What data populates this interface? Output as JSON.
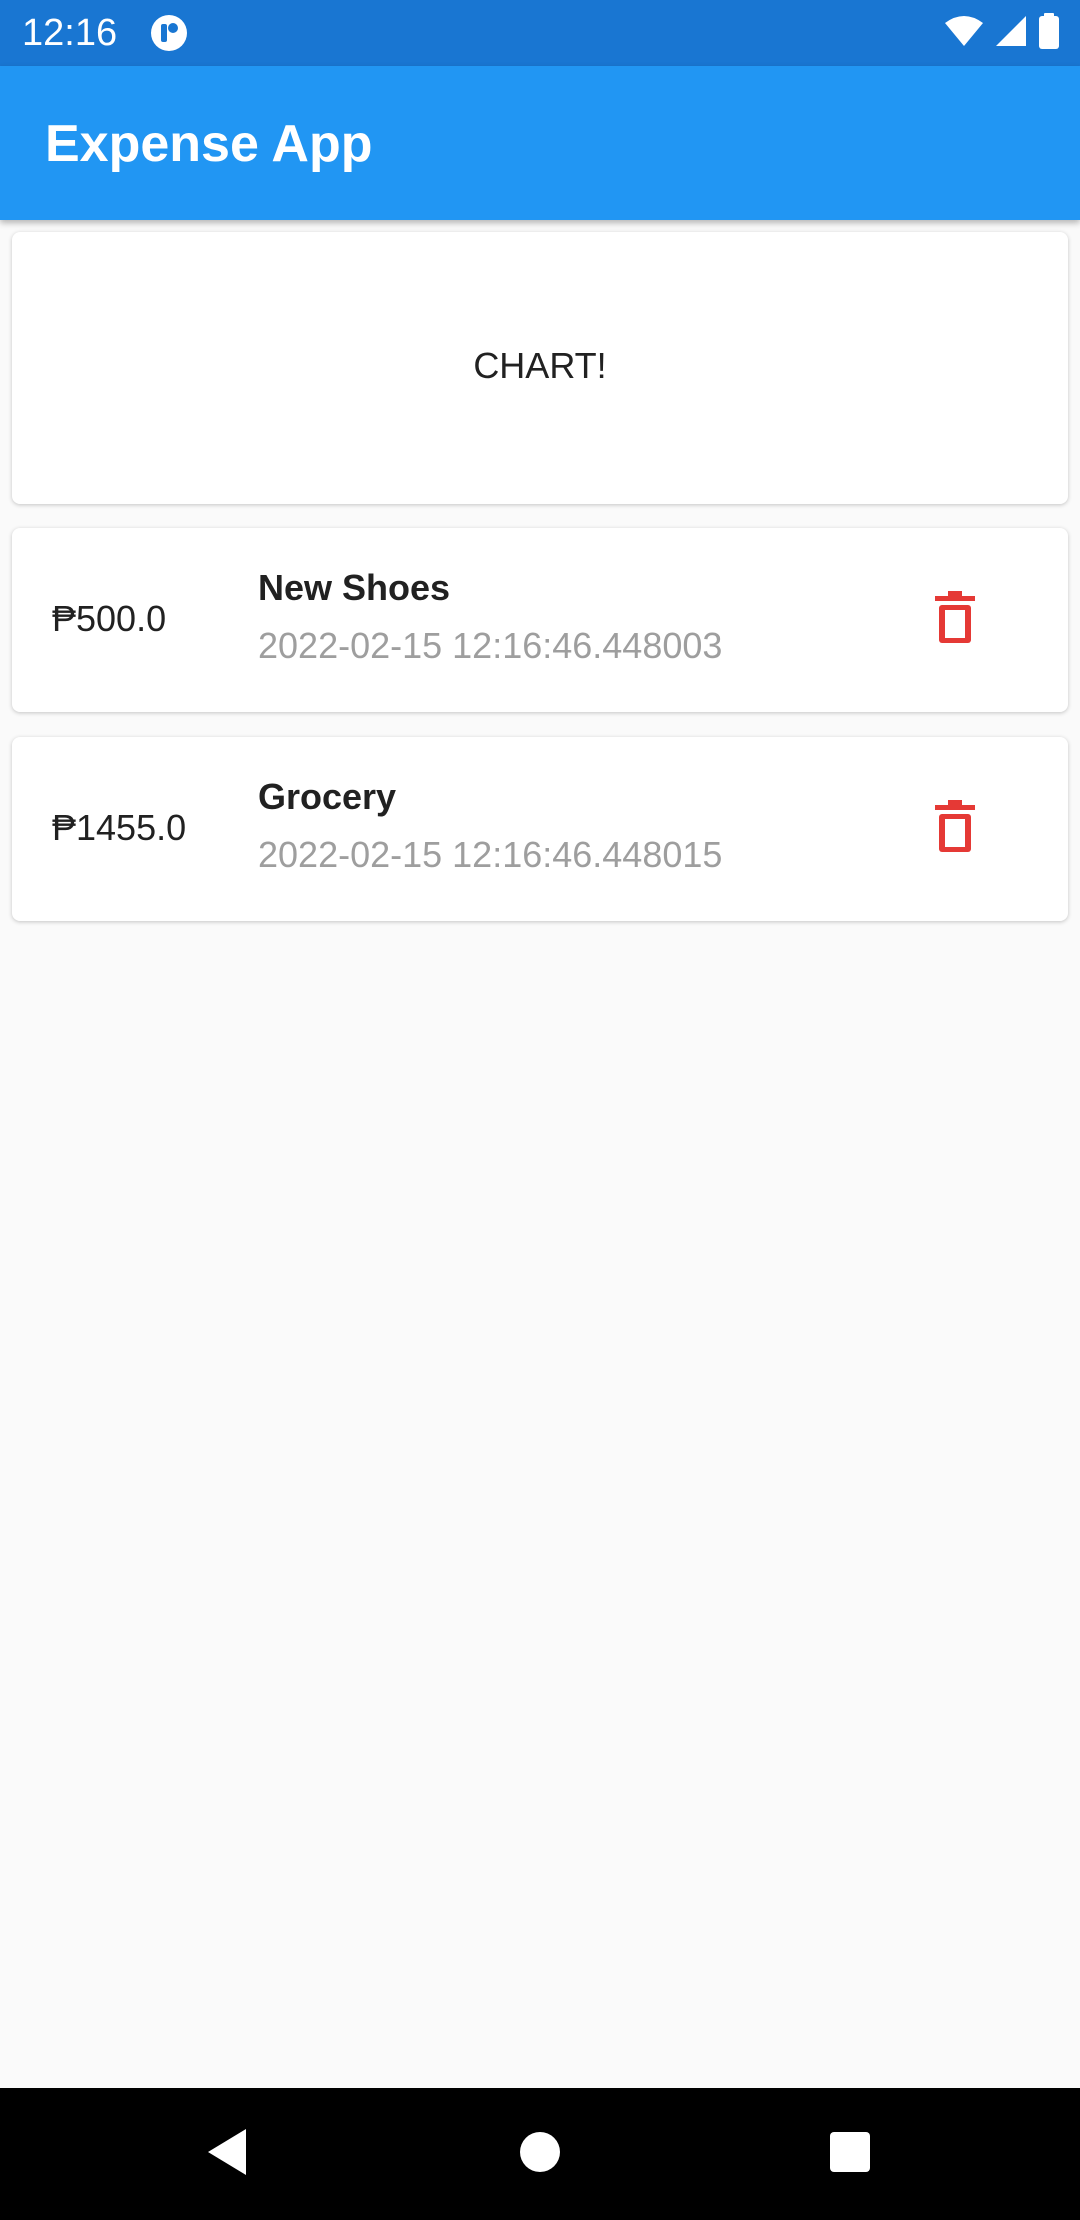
{
  "status_bar": {
    "time": "12:16"
  },
  "app_bar": {
    "title": "Expense App"
  },
  "chart_placeholder": {
    "label": "CHART!"
  },
  "transactions": [
    {
      "amount": "₱500.0",
      "title": "New Shoes",
      "date": "2022-02-15 12:16:46.448003"
    },
    {
      "amount": "₱1455.0",
      "title": "Grocery",
      "date": "2022-02-15 12:16:46.448015"
    }
  ],
  "icons": {
    "delete": "trash-icon",
    "back": "back-triangle-icon",
    "home": "home-circle-icon",
    "recents": "recents-square-icon"
  },
  "colors": {
    "primary": "#2196f3",
    "primary_dark": "#1976d2",
    "delete": "#e53935",
    "subtitle": "#9e9e9e",
    "background": "#fafafa"
  }
}
